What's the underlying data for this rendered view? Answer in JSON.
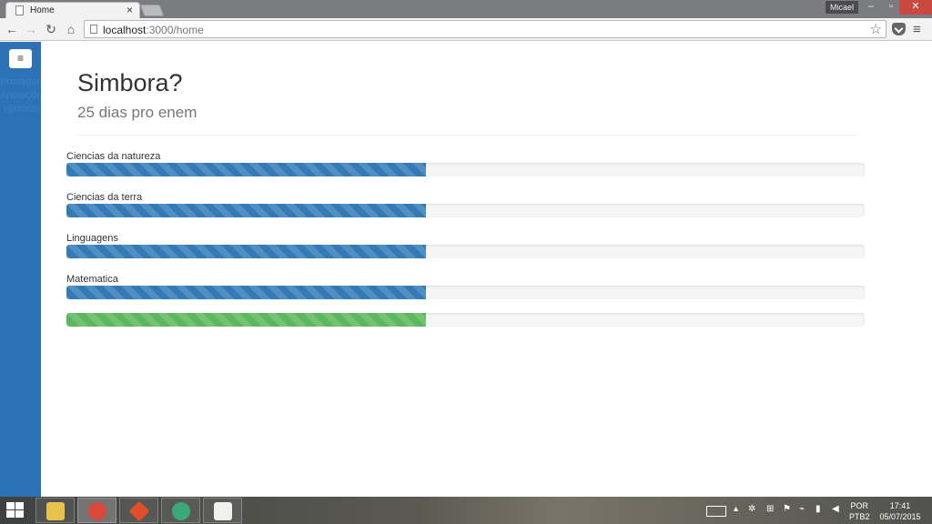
{
  "browser": {
    "tab_title": "Home",
    "tab_close": "×",
    "user_badge": "Micael",
    "window_controls": {
      "minimize": "–",
      "maximize": "▫",
      "close": "✕"
    },
    "nav": {
      "back": "←",
      "forward": "→",
      "reload": "↻",
      "home": "⌂"
    },
    "url_host": "localhost",
    "url_path": ":3000/home",
    "star": "☆",
    "menu": "≡"
  },
  "sidebar": {
    "toggle": "≡",
    "links": [
      "Postagem",
      "Anotações",
      "Histórico"
    ]
  },
  "page": {
    "title": "Simbora?",
    "subtitle": "25 dias pro enem"
  },
  "progress": {
    "colors": {
      "blue": "#337ab7",
      "green": "#5cb85c"
    },
    "bars": [
      {
        "label": "Ciencias da natureza",
        "percent": 45,
        "color": "blue"
      },
      {
        "label": "Ciencias da terra",
        "percent": 45,
        "color": "blue"
      },
      {
        "label": "Linguagens",
        "percent": 45,
        "color": "blue"
      },
      {
        "label": "Matematica",
        "percent": 45,
        "color": "blue"
      },
      {
        "label": "",
        "percent": 45,
        "color": "green"
      }
    ]
  },
  "taskbar": {
    "apps": [
      {
        "name": "file-explorer-icon",
        "color": "#e8c24a"
      },
      {
        "name": "chrome-icon",
        "color": "#d9493b"
      },
      {
        "name": "git-icon",
        "color": "#e04e2a"
      },
      {
        "name": "atom-icon",
        "color": "#3aa878"
      },
      {
        "name": "slack-icon",
        "color": "#f0f0f0"
      }
    ],
    "language": "POR",
    "layout": "PTB2",
    "time": "17:41",
    "date": "05/07/2015"
  }
}
